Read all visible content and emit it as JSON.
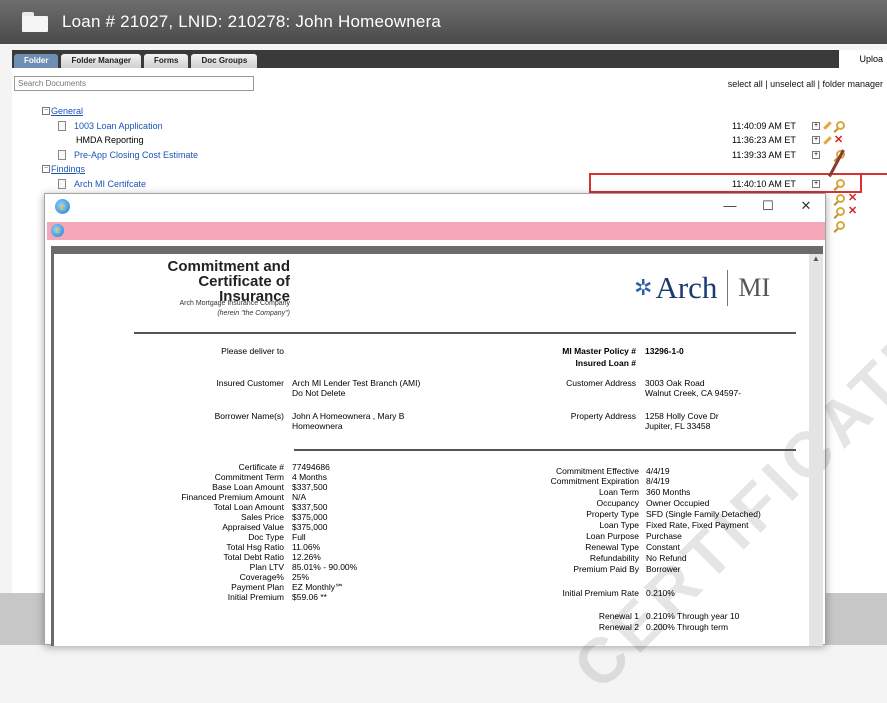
{
  "window": {
    "title": "Loan # 21027, LNID: 210278: John Homeownera"
  },
  "tabs": [
    {
      "label": "Folder"
    },
    {
      "label": "Folder Manager"
    },
    {
      "label": "Forms"
    },
    {
      "label": "Doc Groups"
    }
  ],
  "toolbar": {
    "upload_label": "Uploa",
    "search_placeholder": "Search Documents",
    "select_all": "select all",
    "unselect_all": "unselect all",
    "folder_manager": "folder manager",
    "separator": " | "
  },
  "groups": [
    {
      "label": "General",
      "toggle": "⊟",
      "docs": [
        {
          "label": "1003 Loan Application",
          "time": "11:40:09 AM ET"
        },
        {
          "label": "HMDA Reporting",
          "time": "11:36:23 AM ET"
        },
        {
          "label": "Pre-App Closing Cost Estimate",
          "time": "11:39:33 AM ET"
        }
      ]
    },
    {
      "label": "Findings",
      "toggle": "⊟",
      "docs": [
        {
          "label": "Arch MI Certifcate",
          "time": "11:40:10 AM ET"
        }
      ]
    }
  ],
  "popup": {
    "window_controls": {
      "minimize": "—",
      "maximize": "☐",
      "close": "✕"
    },
    "certificate": {
      "title_line1": "Commitment and",
      "title_line2": "Certificate of Insurance",
      "company": "Arch Mortgage Insurance Company",
      "company_note": "(herein \"the Company\")",
      "logo_text": "Arch",
      "logo_mi": "MI",
      "watermark": "CERTIFICATE",
      "please_deliver_label": "Please deliver to",
      "master_policy_label": "MI Master Policy #",
      "master_policy_value": "13296-1-0",
      "insured_loan_label": "Insured Loan #",
      "insured_customer_label": "Insured Customer",
      "insured_customer_value_1": "Arch MI Lender Test Branch (AMI)",
      "insured_customer_value_2": "Do Not Delete",
      "customer_address_label": "Customer Address",
      "customer_address_1": "3003 Oak Road",
      "customer_address_2": "Walnut Creek, CA 94597-",
      "borrower_label": "Borrower Name(s)",
      "borrower_value_1": "John A Homeownera , Mary B",
      "borrower_value_2": "Homeownera",
      "property_address_label": "Property Address",
      "property_address_1": "1258 Holly Cove Dr",
      "property_address_2": "Jupiter, FL 33458",
      "left_fields": [
        {
          "label": "Certificate #",
          "value": "77494686"
        },
        {
          "label": "Commitment Term",
          "value": "4 Months"
        },
        {
          "label": "Base Loan Amount",
          "value": "$337,500"
        },
        {
          "label": "Financed Premium Amount",
          "value": "N/A"
        },
        {
          "label": "Total Loan Amount",
          "value": "$337,500"
        },
        {
          "label": "Sales Price",
          "value": "$375,000"
        },
        {
          "label": "Appraised Value",
          "value": "$375,000"
        },
        {
          "label": "Doc Type",
          "value": "Full"
        },
        {
          "label": "Total Hsg Ratio",
          "value": "11.06%"
        },
        {
          "label": "Total Debt Ratio",
          "value": "12.26%"
        },
        {
          "label": "Plan LTV",
          "value": "85.01% - 90.00%"
        },
        {
          "label": "Coverage%",
          "value": "25%"
        },
        {
          "label": "Payment Plan",
          "value": "EZ Monthly℠"
        },
        {
          "label": "Initial Premium",
          "value": "$59.06 **"
        }
      ],
      "right_fields": [
        {
          "label": "Commitment Effective",
          "value": "4/4/19"
        },
        {
          "label": "Commitment Expiration",
          "value": "8/4/19"
        },
        {
          "label": "Loan Term",
          "value": "360 Months"
        },
        {
          "label": "Occupancy",
          "value": "Owner Occupied"
        },
        {
          "label": "Property Type",
          "value": "SFD (Single Family Detached)"
        },
        {
          "label": "Loan Type",
          "value": "Fixed Rate, Fixed Payment"
        },
        {
          "label": "Loan Purpose",
          "value": "Purchase"
        },
        {
          "label": "Renewal Type",
          "value": "Constant"
        },
        {
          "label": "Refundability",
          "value": "No Refund"
        },
        {
          "label": "Premium Paid By",
          "value": "Borrower"
        }
      ],
      "initial_premium_rate_label": "Initial Premium Rate",
      "initial_premium_rate_value": "0.210%",
      "renewal_1_label": "Renewal 1",
      "renewal_1_value": "0.210% Through year 10",
      "renewal_2_label": "Renewal 2",
      "renewal_2_value": "0.200% Through term"
    }
  },
  "colors": {
    "link": "#1a55b5",
    "highlight": "#d83131",
    "address_bar": "#f4a7b6",
    "active_tab": "#6f8fb2"
  }
}
